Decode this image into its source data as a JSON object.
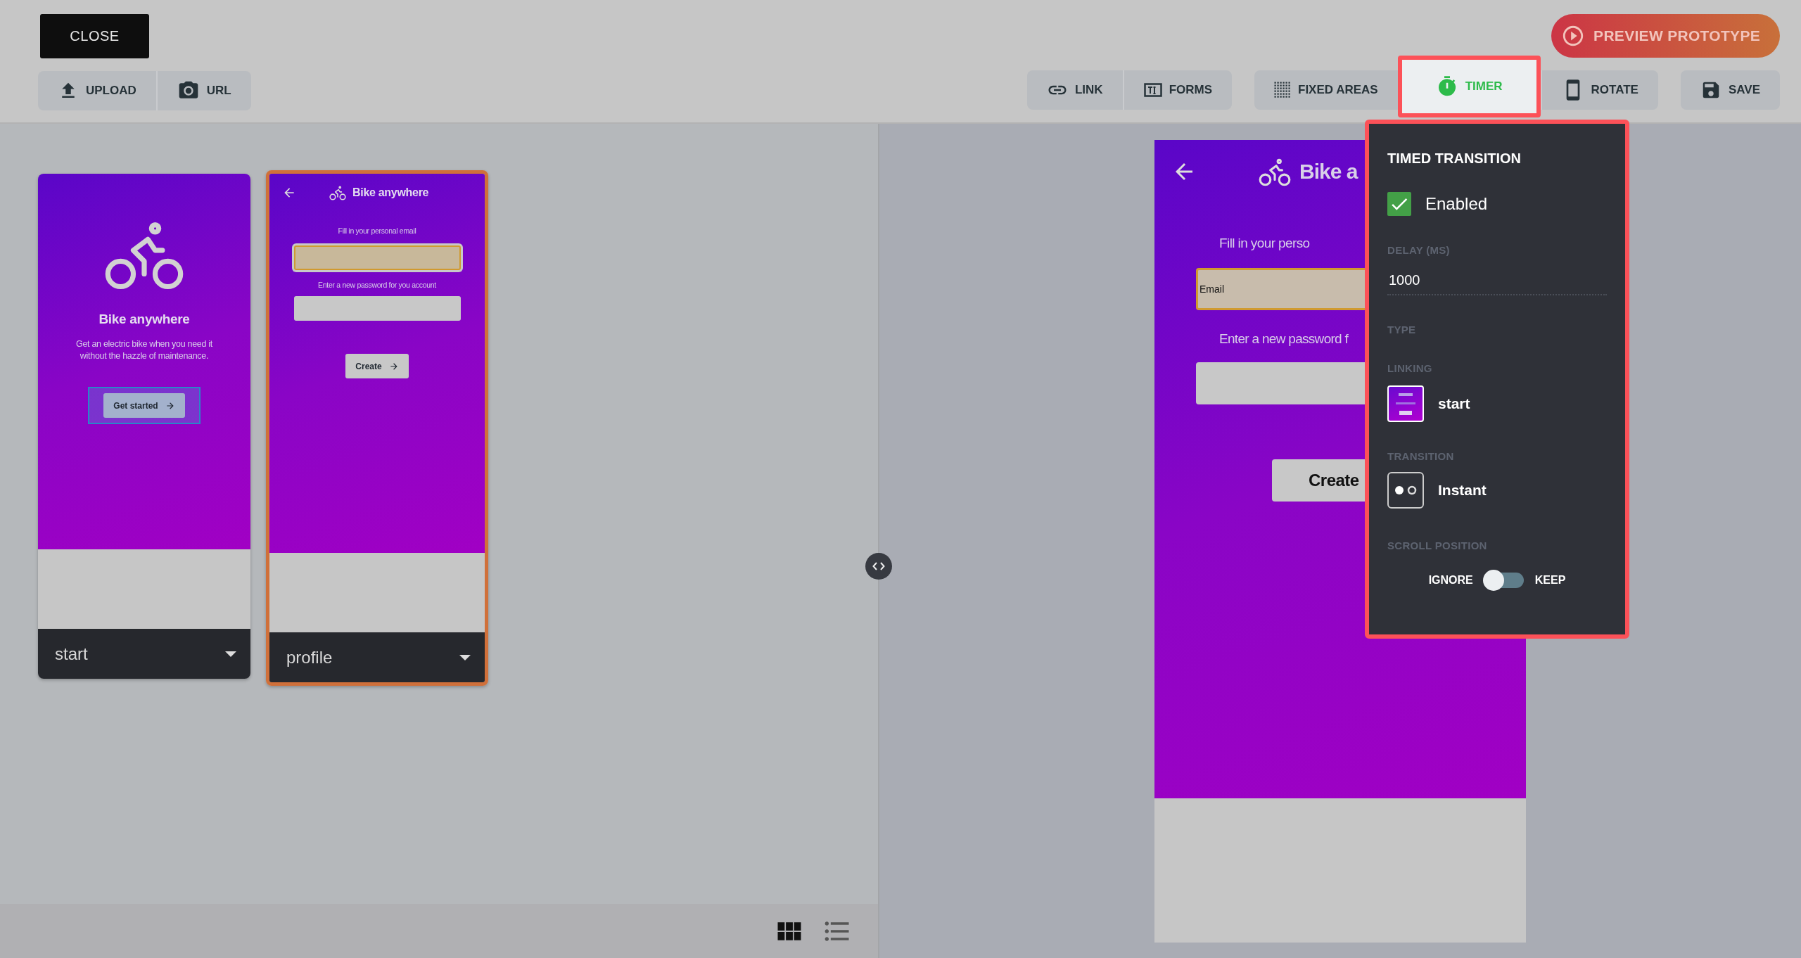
{
  "toolbar": {
    "close": "CLOSE",
    "preview": "PREVIEW PROTOTYPE",
    "groups": [
      {
        "items": [
          {
            "label": "UPLOAD"
          },
          {
            "label": "URL"
          }
        ]
      },
      {
        "items": [
          {
            "label": "LINK",
            "selected": false
          },
          {
            "label": "FORMS",
            "selected": false
          }
        ]
      },
      {
        "items": [
          {
            "label": "FIXED AREAS",
            "selected": false
          },
          {
            "label": "TIMER",
            "selected": true
          },
          {
            "label": "ROTATE",
            "selected": false
          }
        ]
      },
      {
        "items": [
          {
            "label": "SAVE",
            "selected": false
          }
        ]
      }
    ]
  },
  "screens": [
    {
      "name": "start",
      "selected": false,
      "kind": "welcome",
      "title": "Bike anywhere",
      "text": "Get an electric bike when you need it without the hazzle of maintenance.",
      "button": "Get started",
      "linked": true
    },
    {
      "name": "profile",
      "selected": true,
      "kind": "form",
      "title": "Bike anywhere",
      "email_label": "Fill in your personal email",
      "password_label": "Enter a new password for you account",
      "button": "Create"
    }
  ],
  "view_modes": [
    {
      "selected": true
    },
    {
      "selected": false
    }
  ],
  "preview": {
    "title": "Bike a",
    "email_label": "Fill in your perso",
    "email_placeholder": "Email",
    "password_label": "Enter a new password f",
    "button": "Create"
  },
  "panel": {
    "title": "TIMED TRANSITION",
    "enabled": {
      "label": "Enabled",
      "checked": true
    },
    "delay": {
      "label": "DELAY (MS)",
      "value": "1000"
    },
    "type_label": "TYPE",
    "linking": {
      "label": "LINKING",
      "screen": "start"
    },
    "transition": {
      "label": "TRANSITION",
      "value": "Instant"
    },
    "scroll": {
      "label": "SCROLL POSITION",
      "off_label": "IGNORE",
      "on_label": "KEEP",
      "keep": false
    }
  }
}
